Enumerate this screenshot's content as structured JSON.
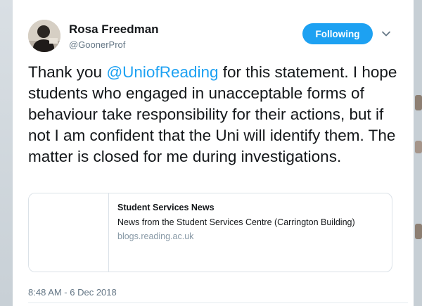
{
  "tweet": {
    "author_name": "Rosa Freedman",
    "author_handle": "@GoonerProf",
    "follow_label": "Following",
    "text_before": "Thank you ",
    "mention": "@UniofReading",
    "text_after": " for this statement. I hope students who engaged in unacceptable forms of behaviour take responsibility for their actions, but if not I am confident that the Uni will identify them. The matter is closed for me during investigations.",
    "link_card": {
      "title": "Student Services News",
      "description": "News from the Student Services Centre (Carrington Building)",
      "domain": "blogs.reading.ac.uk"
    },
    "timestamp": "8:48 AM - 6 Dec 2018"
  },
  "icons": {
    "avatar": "avatar",
    "more": "chevron-down-icon"
  },
  "colors": {
    "accent": "#1da1f2",
    "text": "#14171a",
    "muted": "#657786",
    "border": "#dbe2e8"
  }
}
